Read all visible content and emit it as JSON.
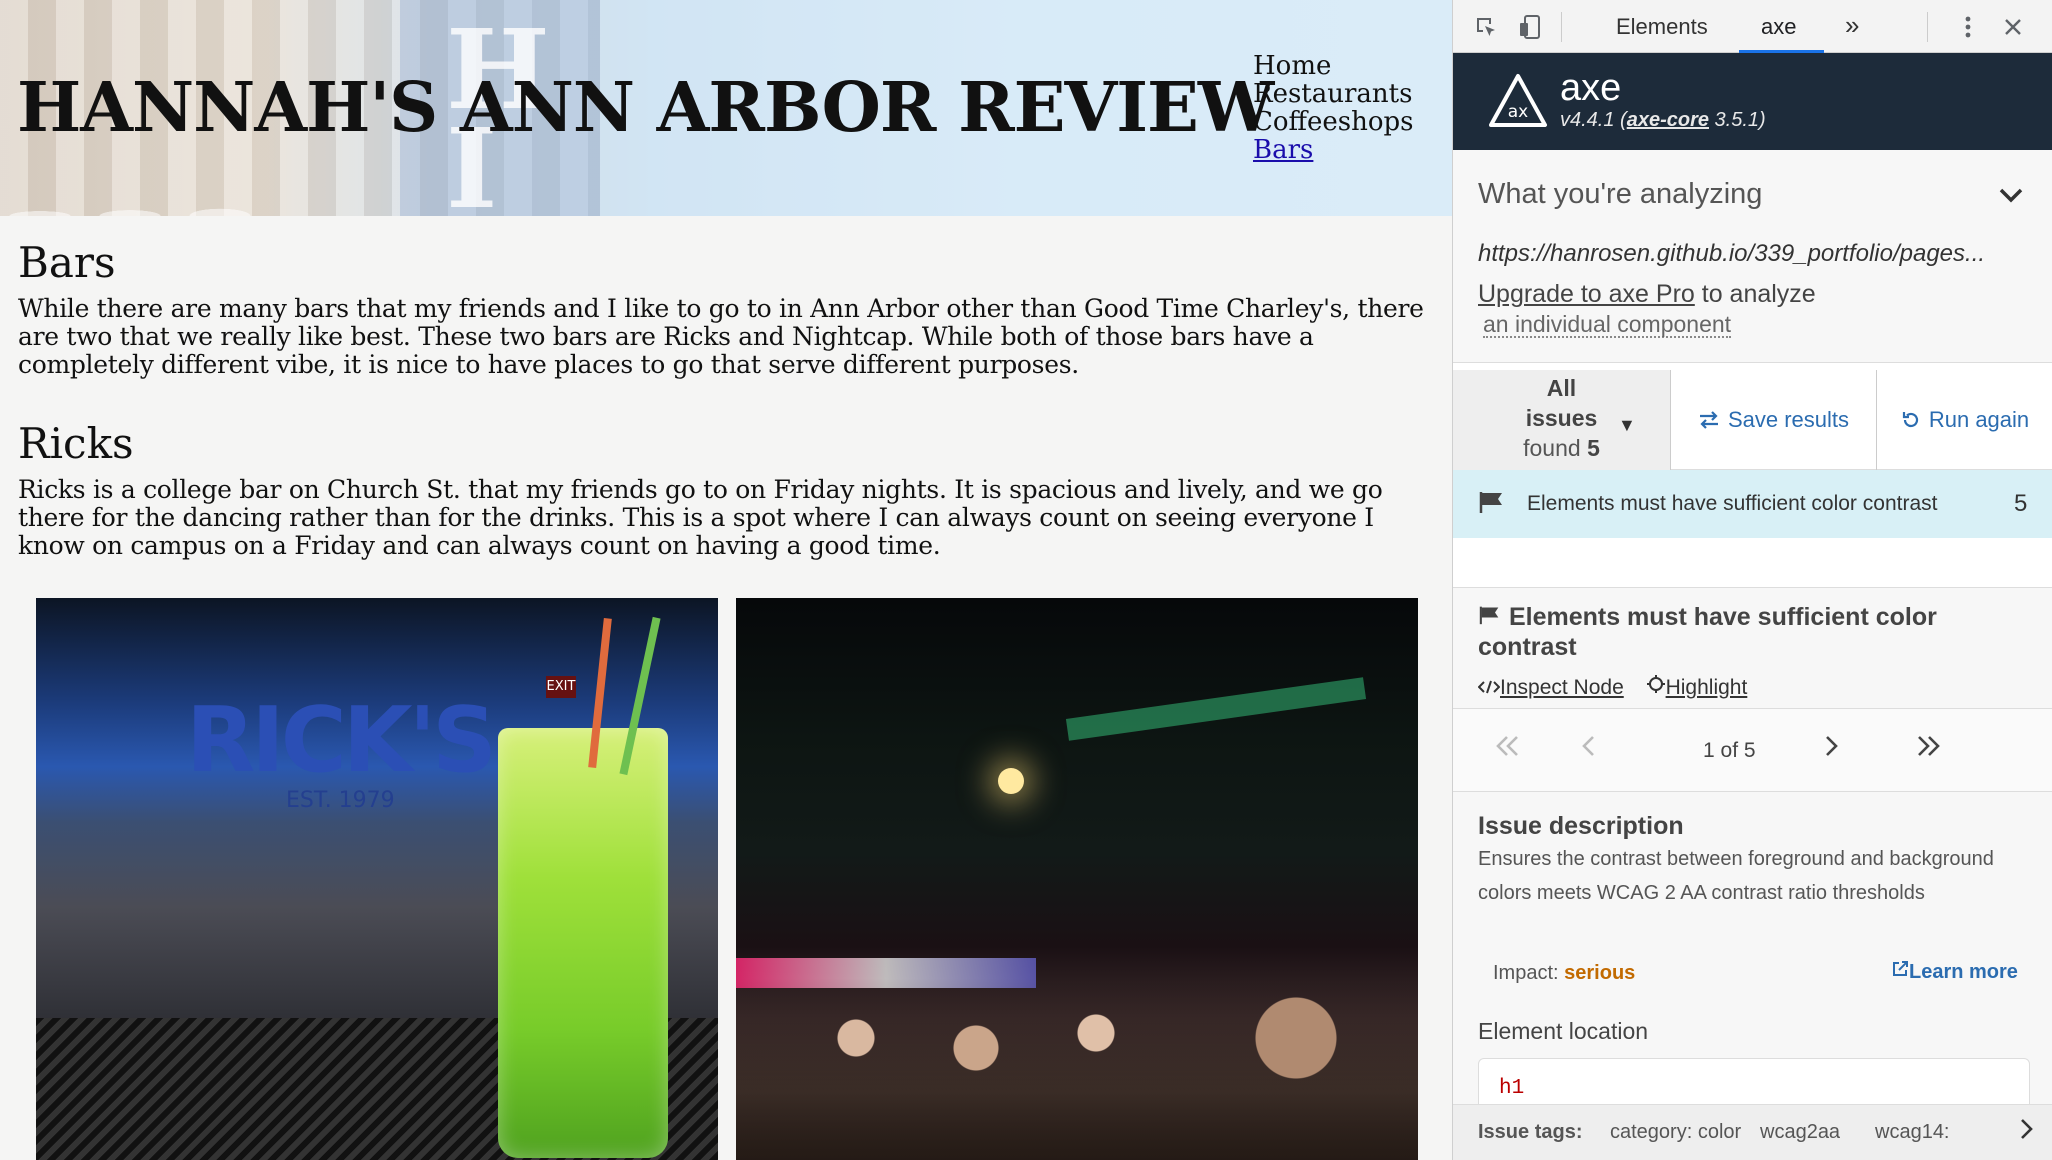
{
  "site": {
    "title": "HANNAH'S ANN ARBOR REVIEW",
    "nav": [
      "Home",
      "Restaurants",
      "Coffeeshops",
      "Bars"
    ],
    "active_nav": "Bars"
  },
  "content": {
    "h_bars": "Bars",
    "p_bars": "While there are many bars that my friends and I like to go to in Ann Arbor other than Good Time Charley's, there are two that we really like best. These two bars are Ricks and Nightcap. While both of those bars have a completely different vibe, it is nice to have places to go that serve different purposes.",
    "h_ricks": "Ricks",
    "p_ricks": "Ricks is a college bar on Church St. that my friends go to on Friday nights. It is spacious and lively, and we go there for the dancing rather than for the drinks. This is a spot where I can always count on seeing everyone I know on campus on a Friday and can always count on having a good time.",
    "photo1_wall": "RICK'S",
    "photo1_est": "EST. 1979",
    "photo1_exit": "EXIT"
  },
  "devtools": {
    "tabs": [
      "Elements",
      "axe"
    ],
    "active_tab": "axe",
    "more_tabs": "»"
  },
  "axe": {
    "name": "axe",
    "version": "v4.4.1",
    "core_label": "axe-core",
    "core_version": "3.5.1",
    "analyzing_title": "What you're analyzing",
    "url": "https://hanrosen.github.io/339_portfolio/pages...",
    "upgrade_link": "Upgrade to axe Pro",
    "upgrade_suffix": " to analyze",
    "component": "an individual component",
    "all_issues_l1": "All",
    "all_issues_l2": "issues",
    "found_label": "found",
    "found_count": "5",
    "save_results": "Save results",
    "run_again": "Run again",
    "issue_row_text": "Elements must have sufficient color contrast",
    "issue_row_count": "5",
    "detail_title": "Elements must have sufficient color contrast",
    "inspect_node": "Inspect Node",
    "highlight": "Highlight",
    "pager_text": "1 of 5",
    "desc_heading": "Issue description",
    "desc_text": "Ensures the contrast between foreground and background colors meets WCAG 2 AA contrast ratio thresholds",
    "impact_label": "Impact:",
    "impact_value": "serious",
    "learn_more": "Learn more",
    "location_heading": "Element location",
    "location_value": "h1",
    "tags_label": "Issue tags:",
    "tags": [
      "category: color",
      "wcag2aa",
      "wcag14:"
    ]
  },
  "colors": {
    "axe_header": "#1d2b3a",
    "link_blue": "#2b6cb0",
    "issue_highlight": "#d8f0f6",
    "impact_serious": "#c26a00",
    "tab_underline": "#1a73e8"
  }
}
